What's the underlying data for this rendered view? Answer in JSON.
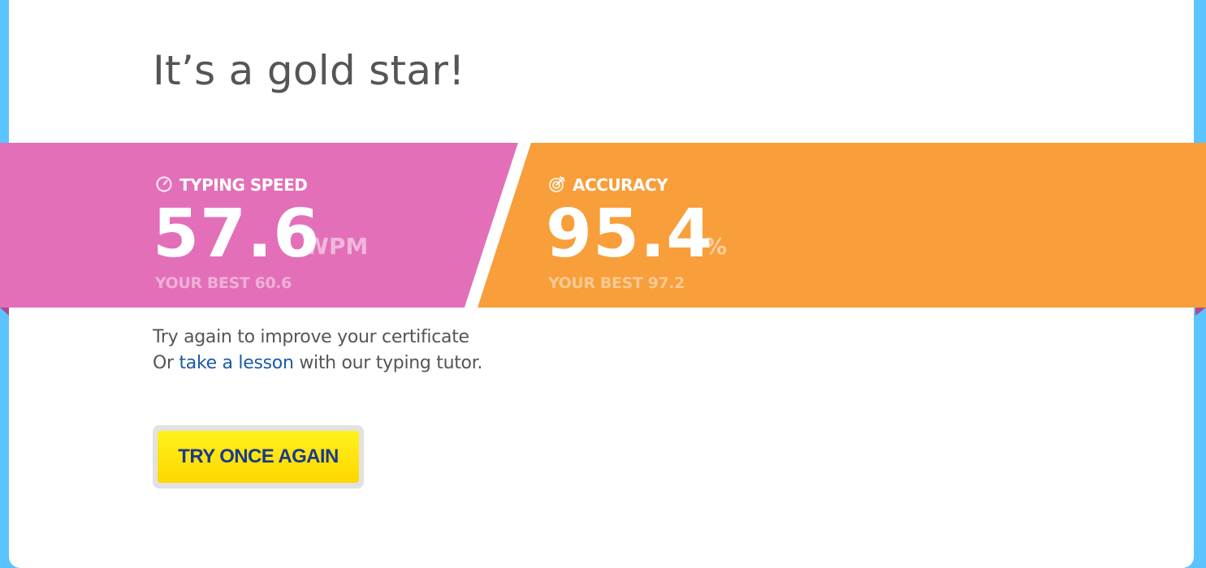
{
  "heading": "It’s a gold star!",
  "speed": {
    "label": "TYPING SPEED",
    "value": "57.6",
    "unit": "WPM",
    "best": "YOUR BEST 60.6",
    "icon": "stopwatch-icon",
    "color": "#e36fb8"
  },
  "accuracy": {
    "label": "ACCURACY",
    "value": "95.4",
    "unit": "%",
    "best": "YOUR BEST 97.2",
    "icon": "target-icon",
    "color": "#f89e3a"
  },
  "message": {
    "line1": "Try again to improve your certificate",
    "line2_prefix": "Or ",
    "lesson_link": "take a lesson",
    "line2_suffix": " with our typing tutor."
  },
  "button": {
    "label": "TRY ONCE AGAIN",
    "color": "#ffe60a"
  },
  "colors": {
    "background": "#5bc4ff",
    "card": "#ffffff",
    "link": "#1a5aa6"
  }
}
